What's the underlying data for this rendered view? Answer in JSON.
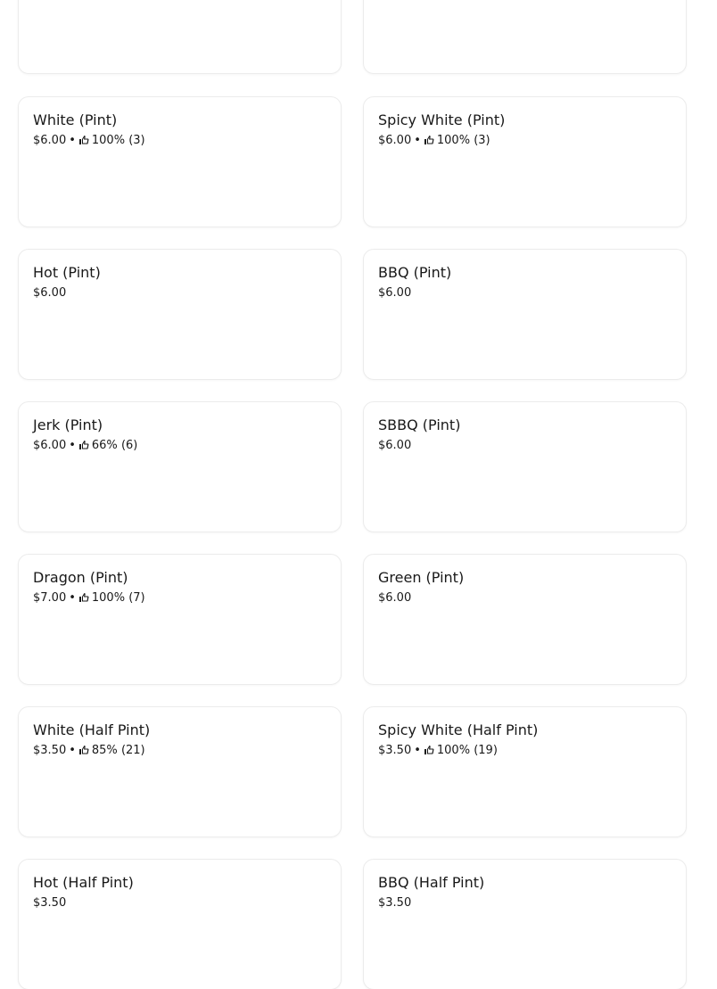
{
  "menu_items": [
    {
      "name": "",
      "price": "",
      "rating": null
    },
    {
      "name": "",
      "price": "",
      "rating": null
    },
    {
      "name": "White (Pint)",
      "price": "$6.00",
      "rating": {
        "percent": "100%",
        "count": "(3)"
      }
    },
    {
      "name": "Spicy White (Pint)",
      "price": "$6.00",
      "rating": {
        "percent": "100%",
        "count": "(3)"
      }
    },
    {
      "name": "Hot (Pint)",
      "price": "$6.00",
      "rating": null
    },
    {
      "name": "BBQ (Pint)",
      "price": "$6.00",
      "rating": null
    },
    {
      "name": "Jerk (Pint)",
      "price": "$6.00",
      "rating": {
        "percent": "66%",
        "count": "(6)"
      }
    },
    {
      "name": "SBBQ (Pint)",
      "price": "$6.00",
      "rating": null
    },
    {
      "name": "Dragon (Pint)",
      "price": "$7.00",
      "rating": {
        "percent": "100%",
        "count": "(7)"
      }
    },
    {
      "name": "Green (Pint)",
      "price": "$6.00",
      "rating": null
    },
    {
      "name": "White (Half Pint)",
      "price": "$3.50",
      "rating": {
        "percent": "85%",
        "count": "(21)"
      }
    },
    {
      "name": "Spicy White (Half Pint)",
      "price": "$3.50",
      "rating": {
        "percent": "100%",
        "count": "(19)"
      }
    },
    {
      "name": "Hot (Half Pint)",
      "price": "$3.50",
      "rating": null
    },
    {
      "name": "BBQ (Half Pint)",
      "price": "$3.50",
      "rating": null
    }
  ],
  "separator": "•",
  "icons": {
    "rating": "thumbs-up-icon"
  },
  "colors": {
    "text": "#191919",
    "card_border": "#ececec",
    "background": "#ffffff"
  }
}
